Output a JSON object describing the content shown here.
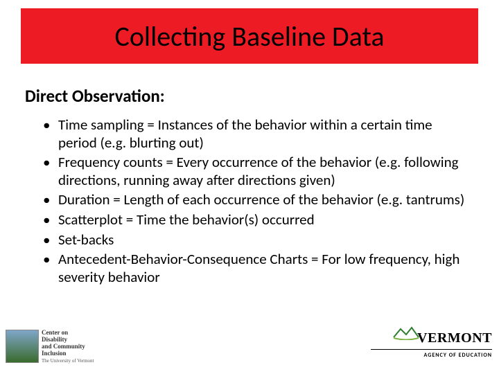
{
  "title": "Collecting Baseline Data",
  "subheading": "Direct Observation:",
  "bullets": [
    "Time sampling = Instances of the behavior within a certain time period (e.g. blurting out)",
    "Frequency counts = Every occurrence of the behavior (e.g. following directions, running away after directions given)",
    "Duration = Length of each occurrence of the behavior (e.g. tantrums)",
    "Scatterplot = Time the behavior(s) occurred",
    "Set-backs",
    "Antecedent-Behavior-Consequence Charts = For low frequency, high severity behavior"
  ],
  "logo_left": {
    "line1": "Center on",
    "line2": "Disability",
    "line3": "and Community",
    "line4": "Inclusion",
    "sub": "The University of Vermont"
  },
  "logo_right": {
    "brand": "VERMONT",
    "tag": "AGENCY OF EDUCATION"
  }
}
